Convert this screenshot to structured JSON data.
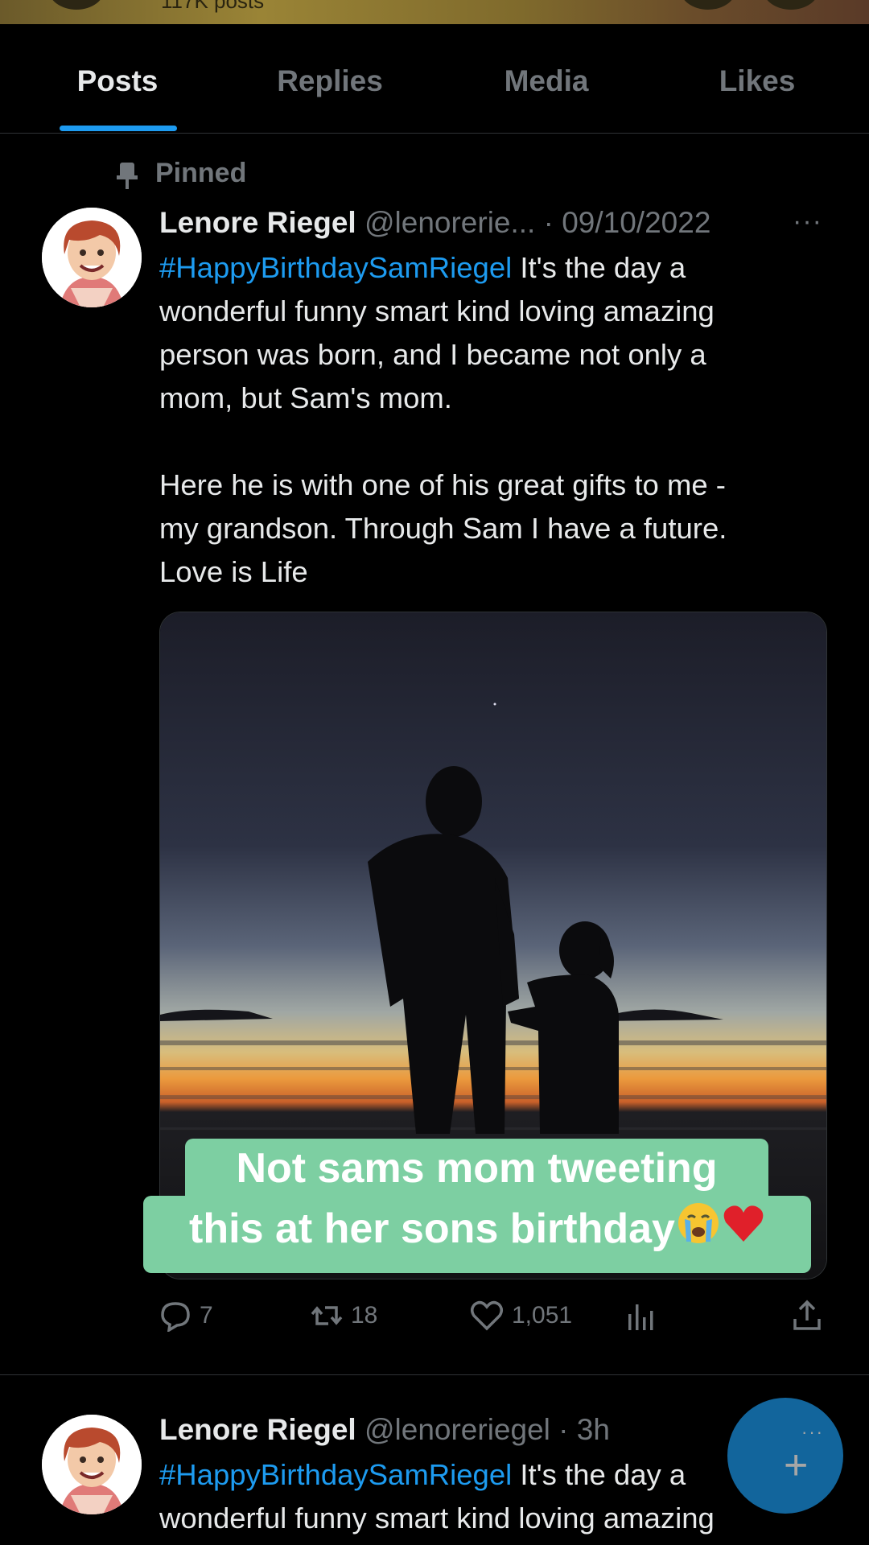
{
  "profile_header": {
    "post_count": "117K posts"
  },
  "tabs": [
    {
      "label": "Posts",
      "active": true
    },
    {
      "label": "Replies",
      "active": false
    },
    {
      "label": "Media",
      "active": false
    },
    {
      "label": "Likes",
      "active": false
    }
  ],
  "pinned_label": "Pinned",
  "pinned_post": {
    "author_name": "Lenore Riegel",
    "meta": "@lenorerie... · 09/10/2022",
    "more": "···",
    "hashtag": "#HappyBirthdaySamRiegel",
    "text_lines": [
      " It's the day a",
      "wonderful funny smart kind loving amazing",
      "person was born, and I became not only a",
      "mom, but Sam's mom.",
      "",
      "Here he is with one of his great gifts to me -",
      "my grandson. Through Sam I have a future.",
      "Love is Life"
    ],
    "caption_line1": "Not sams mom tweeting",
    "caption_line2": "this at her sons birthday",
    "stats": {
      "replies": "7",
      "reposts": "18",
      "likes": "1,051"
    }
  },
  "second_post": {
    "author_name": "Lenore Riegel",
    "meta": "@lenoreriegel · 3h",
    "hashtag": "#HappyBirthdaySamRiegel",
    "text_line1": " It's the day a",
    "text_line2": "wonderful funny smart kind loving amazing"
  },
  "fab": {
    "plus": "+",
    "dots": "···"
  },
  "icons": {
    "pin": "pin-icon",
    "reply": "reply-icon",
    "repost": "repost-icon",
    "like": "heart-icon",
    "views": "views-icon",
    "share": "share-icon",
    "compose": "compose-plus-icon"
  },
  "colors": {
    "accent": "#1d9bf0",
    "caption_bg": "#7dcfa2",
    "muted": "#71767b"
  }
}
